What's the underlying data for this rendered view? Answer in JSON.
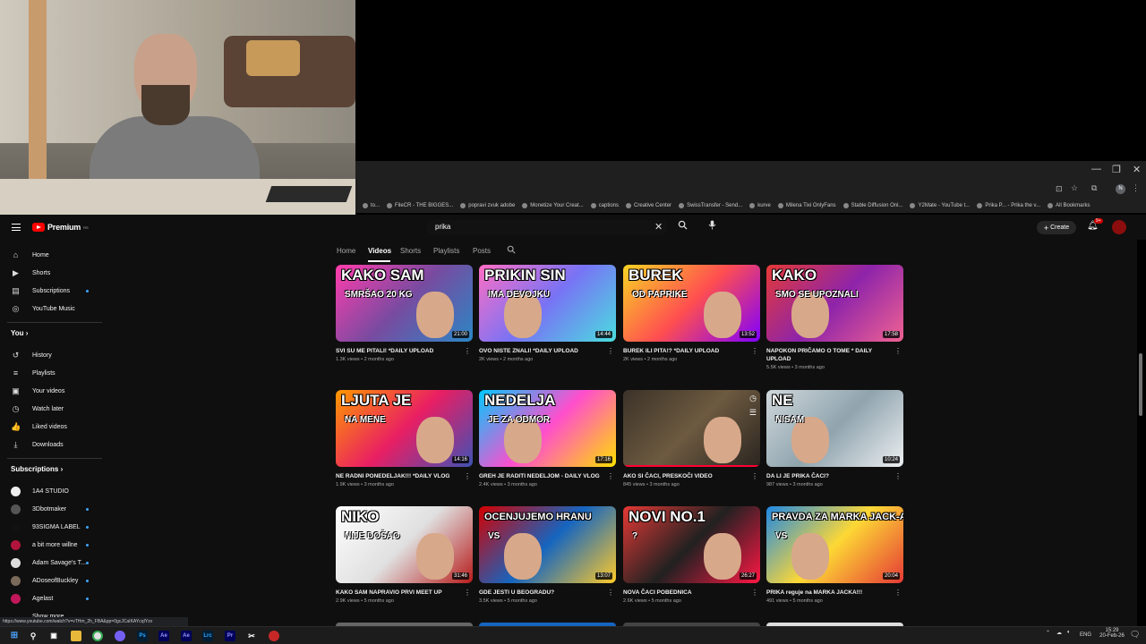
{
  "browser": {
    "window_controls": [
      "—",
      "❐",
      "✕"
    ],
    "profile_initial": "N",
    "bookmarks": [
      "to...",
      "FileCR - THE BIGGES...",
      "popravi zvuk adobe",
      "Monetize Your Creat...",
      "captions",
      "Creative Center",
      "SwissTransfer - Send...",
      "kurve",
      "Milena Tixi OnlyFans",
      "Stable Diffusion Onl...",
      "Y2Mate - YouTube t...",
      "Prika P... - Prika the v...",
      "All Bookmarks"
    ],
    "status_url": "https://www.youtube.com/watch?v=vTHm_2h_FBA&pp=0gcJCaIKAYcqIYzv"
  },
  "header": {
    "brand": "Premium",
    "brand_sup": "RS",
    "search_query": "prika",
    "create_label": "Create",
    "notif_count": "9+"
  },
  "sidebar": {
    "main": [
      {
        "label": "Home",
        "icon": "home-icon",
        "glyph": "⌂"
      },
      {
        "label": "Shorts",
        "icon": "shorts-icon",
        "glyph": "▶"
      },
      {
        "label": "Subscriptions",
        "icon": "subscriptions-icon",
        "glyph": "▤",
        "new": true
      },
      {
        "label": "YouTube Music",
        "icon": "music-icon",
        "glyph": "◎"
      }
    ],
    "you_heading": "You",
    "you": [
      {
        "label": "History",
        "icon": "history-icon",
        "glyph": "↺"
      },
      {
        "label": "Playlists",
        "icon": "playlists-icon",
        "glyph": "≡"
      },
      {
        "label": "Your videos",
        "icon": "your-videos-icon",
        "glyph": "▣"
      },
      {
        "label": "Watch later",
        "icon": "watch-later-icon",
        "glyph": "◷"
      },
      {
        "label": "Liked videos",
        "icon": "liked-icon",
        "glyph": "👍"
      },
      {
        "label": "Downloads",
        "icon": "downloads-icon",
        "glyph": "⤓"
      }
    ],
    "subs_heading": "Subscriptions",
    "subs": [
      {
        "label": "1A4 STUDIO",
        "color": "#eeeeee",
        "new": false
      },
      {
        "label": "3Dbotmaker",
        "color": "#555555",
        "new": true
      },
      {
        "label": "93SIGMA LABEL",
        "color": "#111111",
        "new": true
      },
      {
        "label": "a bit more willne",
        "color": "#b0143c",
        "new": true
      },
      {
        "label": "Adam Savage's T...",
        "color": "#dddddd",
        "new": true
      },
      {
        "label": "ADoseofBuckley",
        "color": "#7a6a5a",
        "new": true
      },
      {
        "label": "Agelast",
        "color": "#c2185b",
        "new": true
      },
      {
        "label": "Show more",
        "color": "#0f0f0f",
        "new": false
      }
    ]
  },
  "tabs": [
    "Home",
    "Videos",
    "Shorts",
    "Playlists",
    "Posts"
  ],
  "active_tab": "Videos",
  "videos": [
    {
      "title": "SVI SU ME PITALI! *DAILY UPLOAD",
      "views": "1.3K views",
      "age": "2 months ago",
      "duration": "21:00",
      "thumb_text": "KAKO SAM",
      "thumb_sub": "SMRŠAO 20 KG",
      "bg": "linear-gradient(135deg,#ff3cac,#784ba0,#2b86c5)"
    },
    {
      "title": "OVO NISTE ZNALI! *DAILY UPLOAD",
      "views": "2K views",
      "age": "2 months ago",
      "duration": "14:44",
      "thumb_text": "PRIKIN SIN",
      "thumb_sub": "IMA DEVOJKU",
      "bg": "linear-gradient(135deg,#ff6ec4,#7873f5,#4adede)"
    },
    {
      "title": "BUREK ILI PITA!? *DAILY UPLOAD",
      "views": "2K views",
      "age": "2 months ago",
      "duration": "13:52",
      "thumb_text": "BUREK",
      "thumb_sub": "OD PAPRIKE",
      "bg": "linear-gradient(135deg,#f9d423,#ff4e50,#7f00ff)"
    },
    {
      "title": "NAPOKON PRIČAMO O TOME * DAILY UPLOAD",
      "views": "5.5K views",
      "age": "3 months ago",
      "duration": "17:58",
      "thumb_text": "KAKO",
      "thumb_sub": "SMO SE UPOZNALI",
      "bg": "linear-gradient(135deg,#e53935,#8e24aa,#f06292)"
    },
    {
      "title": "NE RADNI PONEDELJAK!!! *DAILY VLOG",
      "views": "1.9K views",
      "age": "3 months ago",
      "duration": "14:16",
      "thumb_text": "LJUTA JE",
      "thumb_sub": "NA MENE",
      "bg": "linear-gradient(135deg,#ff9800,#e91e63,#3f51b5)"
    },
    {
      "title": "GREH JE RADITI NEDELJOM - DAILY VLOG",
      "views": "2.4K views",
      "age": "3 months ago",
      "duration": "17:16",
      "thumb_text": "NEDELJA",
      "thumb_sub": "JE ZA ODMOR",
      "bg": "linear-gradient(135deg,#00c9ff,#ff4ecd,#ffe000)"
    },
    {
      "title": "AKO SI ČACI, PRESKOČI VIDEO",
      "views": "845 views",
      "age": "3 months ago",
      "duration": "",
      "thumb_text": "",
      "thumb_sub": "",
      "bg": "linear-gradient(135deg,#3b3228,#6d5a40,#2a2520)"
    },
    {
      "title": "DA LI JE PRIKA ČACI?",
      "views": "987 views",
      "age": "3 months ago",
      "duration": "10:24",
      "thumb_text": "NE",
      "thumb_sub": "NISAM",
      "bg": "linear-gradient(135deg,#cfd8dc,#90a4ae,#eceff1)"
    },
    {
      "title": "KAKO SAM NAPRAVIO PRVI MEET UP",
      "views": "2.9K views",
      "age": "5 months ago",
      "duration": "31:46",
      "thumb_text": "NIKO",
      "thumb_sub": "NIJE DOŠAO",
      "bg": "linear-gradient(135deg,#ffffff,#e0e0e0,#b71c1c)"
    },
    {
      "title": "GDE JESTI U BEOGRADU?",
      "views": "3.5K views",
      "age": "5 months ago",
      "duration": "13:07",
      "thumb_text": "OCENJUJEMO HRANU",
      "thumb_sub": "VS",
      "bg": "linear-gradient(135deg,#d50000,#1565c0,#ffca28)"
    },
    {
      "title": "NOVA ČACI POBEDNICA",
      "views": "2.6K views",
      "age": "5 months ago",
      "duration": "26:27",
      "thumb_text": "NOVI NO.1",
      "thumb_sub": "?",
      "bg": "linear-gradient(135deg,#e53935,#212121,#ff1744)"
    },
    {
      "title": "PRIKA reguje na MARKA JACKA!!!",
      "views": "491 views",
      "age": "5 months ago",
      "duration": "20:04",
      "thumb_text": "PRAVDA ZA MARKA JACK-A",
      "thumb_sub": "VS",
      "bg": "linear-gradient(135deg,#1e88e5,#fdd835,#e53935)"
    }
  ],
  "taskbar": {
    "lang": "ENG",
    "time": "15:29",
    "date": "20-Feb-26",
    "apps": [
      "Ps",
      "Ae",
      "Ae",
      "Lrc",
      "Pr"
    ]
  }
}
